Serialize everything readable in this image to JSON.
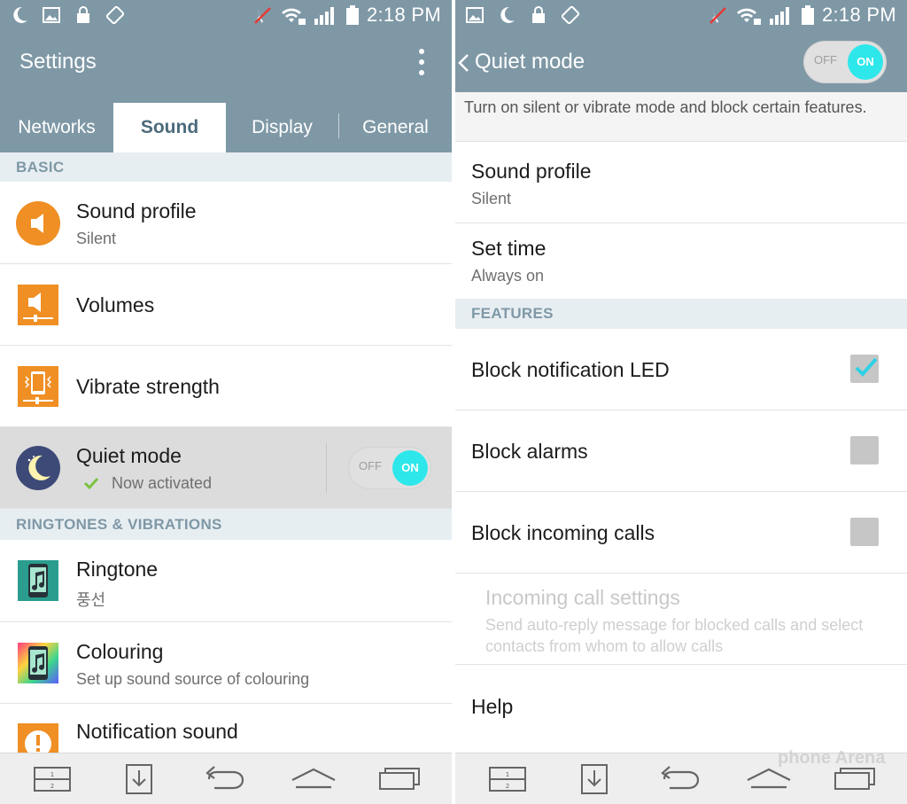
{
  "status_bar": {
    "time": "2:18 PM",
    "left_icons_left": [
      "moon-icon",
      "image-icon",
      "lock-icon",
      "rotate-icon"
    ],
    "left_icons_right": [
      "image-icon",
      "moon-icon",
      "lock-icon",
      "rotate-icon"
    ],
    "right_icons": [
      "mute-icon",
      "wifi-lock-icon",
      "signal-icon",
      "battery-icon"
    ]
  },
  "left": {
    "title": "Settings",
    "tabs": [
      {
        "label": "Networks",
        "active": false
      },
      {
        "label": "Sound",
        "active": true
      },
      {
        "label": "Display",
        "active": false
      },
      {
        "label": "General",
        "active": false
      }
    ],
    "sections": {
      "basic": "BASIC",
      "ringtones": "RINGTONES & VIBRATIONS"
    },
    "items": {
      "sound_profile": {
        "title": "Sound profile",
        "subtitle": "Silent",
        "icon": "speaker-icon"
      },
      "volumes": {
        "title": "Volumes",
        "icon": "volume-slider-icon"
      },
      "vibrate": {
        "title": "Vibrate strength",
        "icon": "vibrate-icon"
      },
      "quiet": {
        "title": "Quiet mode",
        "subtitle": "Now activated",
        "icon": "moon-night-icon",
        "toggle_off": "OFF",
        "toggle_on": "ON",
        "state": "on"
      },
      "ringtone": {
        "title": "Ringtone",
        "subtitle": "풍선",
        "icon": "music-phone-icon"
      },
      "colouring": {
        "title": "Colouring",
        "subtitle": "Set up sound source of colouring",
        "icon": "colouring-icon"
      },
      "notification": {
        "title": "Notification sound",
        "icon": "exclamation-icon"
      }
    }
  },
  "right": {
    "title": "Quiet mode",
    "toggle_off": "OFF",
    "toggle_on": "ON",
    "description": "Turn on silent or vibrate mode and block certain features.",
    "items": {
      "sound_profile": {
        "title": "Sound profile",
        "subtitle": "Silent"
      },
      "set_time": {
        "title": "Set time",
        "subtitle": "Always on"
      }
    },
    "features_header": "FEATURES",
    "features": {
      "led": {
        "title": "Block notification LED",
        "checked": true
      },
      "alarms": {
        "title": "Block alarms",
        "checked": false
      },
      "calls": {
        "title": "Block incoming calls",
        "checked": false
      }
    },
    "incoming": {
      "title": "Incoming call settings",
      "subtitle": "Send auto-reply message for blocked calls and select contacts from whom to allow calls"
    },
    "help": "Help"
  },
  "nav": [
    "dual-window-icon",
    "download-box-icon",
    "back-icon",
    "home-icon",
    "recent-apps-icon"
  ],
  "watermark": "phone Arena",
  "colors": {
    "accent": "#7f98a6",
    "toggle_on": "#2ee7ea",
    "check": "#2ed1e6",
    "orange": "#ef8f24"
  }
}
